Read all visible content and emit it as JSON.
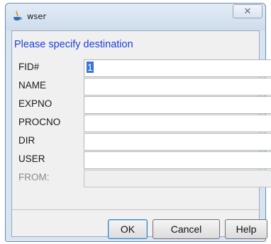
{
  "window": {
    "title": "wser",
    "close_glyph": "✕"
  },
  "dialog": {
    "header": "Please specify destination",
    "fields": [
      {
        "label": "FID#",
        "value": "1",
        "enabled": true
      },
      {
        "label": "NAME",
        "value": "",
        "enabled": true
      },
      {
        "label": "EXPNO",
        "value": "",
        "enabled": true
      },
      {
        "label": "PROCNO",
        "value": "",
        "enabled": true
      },
      {
        "label": "DIR",
        "value": "",
        "enabled": true
      },
      {
        "label": "USER",
        "value": "",
        "enabled": true
      },
      {
        "label": "FROM:",
        "value": "",
        "enabled": false
      }
    ],
    "buttons": {
      "ok": "OK",
      "cancel": "Cancel",
      "help": "Help"
    }
  },
  "icons": {
    "app": "java-icon",
    "close": "close-icon"
  },
  "colors": {
    "header_text": "#1f3fd6",
    "disabled_label": "#8a8a8a",
    "selection": "#3875d7"
  }
}
